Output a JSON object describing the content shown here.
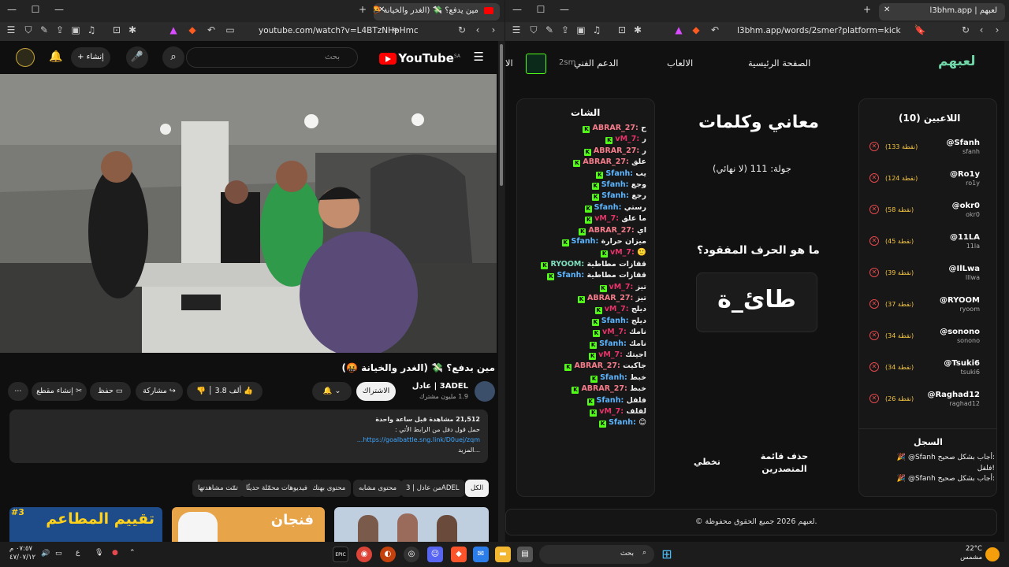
{
  "left_window": {
    "tab_title": "مين يدفع؟ 💸 (الغدر والخيانة 🤬",
    "url": "youtube.com/watch?v=L4BTzNHpHmc",
    "search_placeholder": "بحث",
    "logo_text": "YouTube",
    "logo_region": "SA",
    "create_label": "إنشاء",
    "video_title": "مين يدفع؟ 💸 (الغدر والخيانة 🤬)",
    "channel_name": "3ADEL | عادل",
    "subscribers": "1.9 مليون مشترك",
    "subscribe_label": "الاشتراك",
    "likes": "3.8 ألف",
    "share_label": "مشاركة",
    "save_label": "حفظ",
    "clip_label": "إنشاء مقطع",
    "views": "21,512 مشاهدة قبل ساعة واحدة",
    "desc_line2": "حمل قول دفل من الرابط الأتي :",
    "desc_link": "https://goalbattle.sng.link/D0uej/zqm...",
    "desc_more": "...المزيد",
    "chips": [
      "الكل",
      "من عادل | 3ADEL",
      "محتوى مشابه",
      "محتوى بهتك",
      "فيديوهات محمّلة حديثًا",
      "تمّت مشاهدتها"
    ],
    "thumb1_text": "فنجان",
    "thumb2_text": "تقييم المطاعم",
    "thumb2_num": "#3"
  },
  "right_window": {
    "tab_title": "l3bhm.app | لعبهم",
    "url": "l3bhm.app/words/2smer?platform=kick",
    "logo": "لعبهم",
    "nav": [
      "الصفحة الرئيسية",
      "الالعاب",
      "الدعم الفني",
      "الا"
    ],
    "user_short": "2sm",
    "players_title": "اللاعبين (10)",
    "players": [
      {
        "name": "@Sfanh",
        "sub": "sfanh",
        "pts": "(133 نقطة)"
      },
      {
        "name": "@Ro1y",
        "sub": "ro1y",
        "pts": "(124 نقطة)"
      },
      {
        "name": "@okr0",
        "sub": "okr0",
        "pts": "(58 نقطة)"
      },
      {
        "name": "@11LA",
        "sub": "11la",
        "pts": "(45 نقطة)"
      },
      {
        "name": "@IlLwa",
        "sub": "lllwa",
        "pts": "(39 نقطة)"
      },
      {
        "name": "@RYOOM",
        "sub": "ryoom",
        "pts": "(37 نقطة)"
      },
      {
        "name": "@sonono",
        "sub": "sonono",
        "pts": "(34 نقطة)"
      },
      {
        "name": "@Tsuki6",
        "sub": "tsuki6",
        "pts": "(34 نقطة)"
      },
      {
        "name": "@Raghad12",
        "sub": "raghad12",
        "pts": "(26 نقطة)"
      }
    ],
    "log_title": "السجل",
    "log_lines": [
      "🎉 @Sfanh أجاب بشكل صحيح:",
      "فلفل!",
      "🎉 @Sfanh أجاب بشكل صحيح:"
    ],
    "game_title": "معاني وكلمات",
    "round": "جولة: 111 (لا نهائي)",
    "question": "ما هو الحرف المفقود؟",
    "word": "طائ_ة",
    "btn_leaderboard": "حذف قائمة المتصدرين",
    "btn_skip": "تخطي",
    "chat_title": "الشات",
    "chat": [
      {
        "user": "ABRAR_27",
        "msg": "ح",
        "color": "#f57c8a"
      },
      {
        "user": "vM_7",
        "msg": "ر",
        "color": "#e8336a"
      },
      {
        "user": "ABRAR_27",
        "msg": "ر",
        "color": "#f57c8a"
      },
      {
        "user": "ABRAR_27",
        "msg": "علق",
        "color": "#f57c8a"
      },
      {
        "user": "Sfanh",
        "msg": "يب",
        "color": "#5bb5ff"
      },
      {
        "user": "Sfanh",
        "msg": "وجع",
        "color": "#5bb5ff"
      },
      {
        "user": "Sfanh",
        "msg": "رجع",
        "color": "#5bb5ff"
      },
      {
        "user": "Sfanh",
        "msg": "رستي",
        "color": "#5bb5ff"
      },
      {
        "user": "vM_7",
        "msg": "ما علق",
        "color": "#e8336a"
      },
      {
        "user": "ABRAR_27",
        "msg": "اي",
        "color": "#f57c8a"
      },
      {
        "user": "Sfanh",
        "msg": "ميزان حرارة",
        "color": "#5bb5ff"
      },
      {
        "user": "vM_7",
        "msg": "🙂",
        "color": "#e8336a"
      },
      {
        "user": "RYOOM",
        "msg": "ققازات مطاطية",
        "color": "#7fe0c0"
      },
      {
        "user": "Sfanh",
        "msg": "ققازات مطاطية",
        "color": "#5bb5ff"
      },
      {
        "user": "vM_7",
        "msg": "تيز",
        "color": "#e8336a"
      },
      {
        "user": "ABRAR_27",
        "msg": "تيز",
        "color": "#f57c8a"
      },
      {
        "user": "vM_7",
        "msg": "ديلج",
        "color": "#e8336a"
      },
      {
        "user": "Sfanh",
        "msg": "ديلج",
        "color": "#5bb5ff"
      },
      {
        "user": "vM_7",
        "msg": "نامك",
        "color": "#e8336a"
      },
      {
        "user": "Sfanh",
        "msg": "نامك",
        "color": "#5bb5ff"
      },
      {
        "user": "vM_7",
        "msg": "اجيتك",
        "color": "#e8336a"
      },
      {
        "user": "ABRAR_27",
        "msg": "جاكيت",
        "color": "#f57c8a"
      },
      {
        "user": "Sfanh",
        "msg": "خبط",
        "color": "#5bb5ff"
      },
      {
        "user": "ABRAR_27",
        "msg": "خبط",
        "color": "#f57c8a"
      },
      {
        "user": "Sfanh",
        "msg": "فلفل",
        "color": "#5bb5ff"
      },
      {
        "user": "vM_7",
        "msg": "لفلف",
        "color": "#e8336a"
      },
      {
        "user": "Sfanh",
        "msg": "😊",
        "color": "#5bb5ff"
      }
    ],
    "footer": "© لعبهم 2026 جميع الحقوق محفوظة."
  },
  "taskbar": {
    "time": "٠٧:٥٧ م",
    "date": "٤٧/٠٧/١٢",
    "lang": "ع",
    "search": "بحث",
    "temp": "22°C",
    "weather": "مشمس"
  },
  "colors": {
    "accent_green": "#53fc18",
    "youtube_red": "#ff0000"
  }
}
